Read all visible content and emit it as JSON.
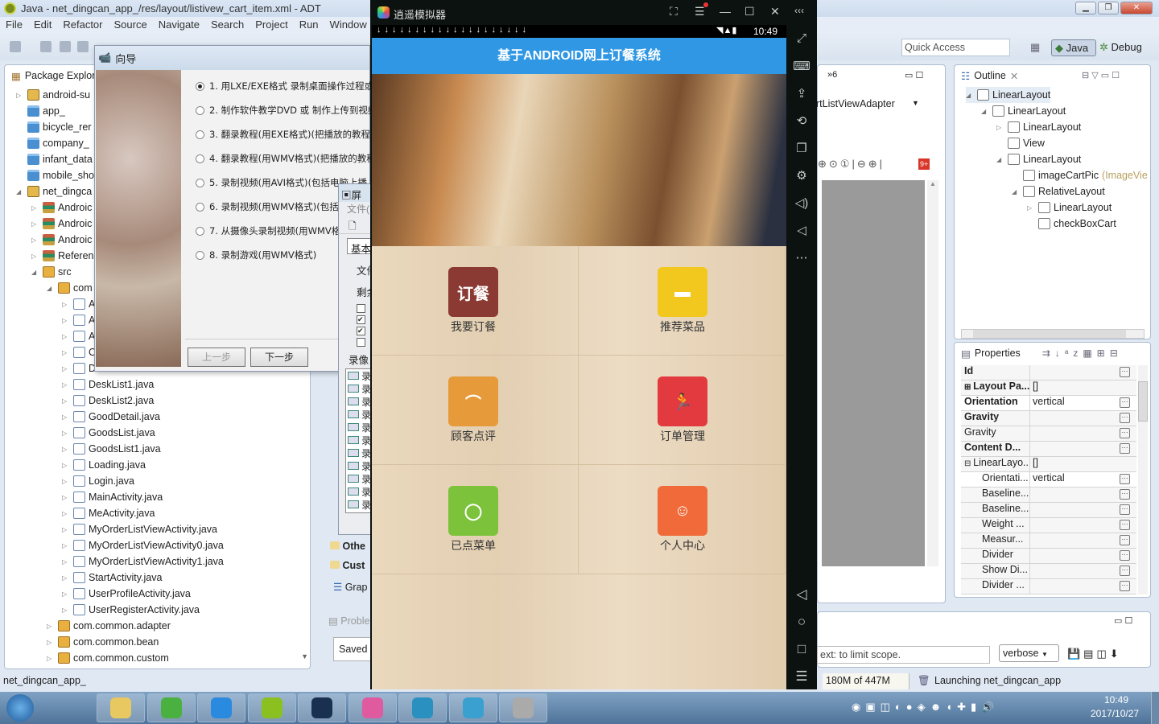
{
  "eclipse": {
    "title": "Java - net_dingcan_app_/res/layout/listivew_cart_item.xml - ADT",
    "menu": [
      "File",
      "Edit",
      "Refactor",
      "Source",
      "Navigate",
      "Search",
      "Project",
      "Run",
      "Window"
    ],
    "quick_access": "Quick Access",
    "perspectives": [
      "Java",
      "Debug"
    ]
  },
  "package_explorer": {
    "title": "Package Explore",
    "items": [
      {
        "label": "android-su",
        "indent": 0,
        "icon": "proj",
        "arrow": "▷"
      },
      {
        "label": "app_",
        "indent": 0,
        "icon": "folder",
        "arrow": ""
      },
      {
        "label": "bicycle_rer",
        "indent": 0,
        "icon": "folder",
        "arrow": ""
      },
      {
        "label": "company_",
        "indent": 0,
        "icon": "folder",
        "arrow": ""
      },
      {
        "label": "infant_data",
        "indent": 0,
        "icon": "folder",
        "arrow": ""
      },
      {
        "label": "mobile_sho",
        "indent": 0,
        "icon": "folder",
        "arrow": ""
      },
      {
        "label": "net_dingca",
        "indent": 0,
        "icon": "proj",
        "arrow": "◢"
      },
      {
        "label": "Androic",
        "indent": 1,
        "icon": "lib",
        "arrow": "▷"
      },
      {
        "label": "Androic",
        "indent": 1,
        "icon": "lib",
        "arrow": "▷"
      },
      {
        "label": "Androic",
        "indent": 1,
        "icon": "lib",
        "arrow": "▷"
      },
      {
        "label": "Referen",
        "indent": 1,
        "icon": "lib",
        "arrow": "▷"
      },
      {
        "label": "src",
        "indent": 1,
        "icon": "pkg",
        "arrow": "◢"
      },
      {
        "label": "com",
        "indent": 2,
        "icon": "pkg",
        "arrow": "◢"
      },
      {
        "label": "A",
        "indent": 3,
        "icon": "java",
        "arrow": "▷"
      },
      {
        "label": "A",
        "indent": 3,
        "icon": "java",
        "arrow": "▷"
      },
      {
        "label": "A",
        "indent": 3,
        "icon": "java",
        "arrow": "▷"
      },
      {
        "label": "C",
        "indent": 3,
        "icon": "java",
        "arrow": "▷"
      },
      {
        "label": "D",
        "indent": 3,
        "icon": "java",
        "arrow": "▷"
      },
      {
        "label": "DeskList1.java",
        "indent": 3,
        "icon": "java",
        "arrow": "▷"
      },
      {
        "label": "DeskList2.java",
        "indent": 3,
        "icon": "java",
        "arrow": "▷"
      },
      {
        "label": "GoodDetail.java",
        "indent": 3,
        "icon": "java",
        "arrow": "▷"
      },
      {
        "label": "GoodsList.java",
        "indent": 3,
        "icon": "java",
        "arrow": "▷"
      },
      {
        "label": "GoodsList1.java",
        "indent": 3,
        "icon": "java",
        "arrow": "▷"
      },
      {
        "label": "Loading.java",
        "indent": 3,
        "icon": "java",
        "arrow": "▷"
      },
      {
        "label": "Login.java",
        "indent": 3,
        "icon": "java",
        "arrow": "▷"
      },
      {
        "label": "MainActivity.java",
        "indent": 3,
        "icon": "java",
        "arrow": "▷"
      },
      {
        "label": "MeActivity.java",
        "indent": 3,
        "icon": "java",
        "arrow": "▷"
      },
      {
        "label": "MyOrderListViewActivity.java",
        "indent": 3,
        "icon": "java",
        "arrow": "▷"
      },
      {
        "label": "MyOrderListViewActivity0.java",
        "indent": 3,
        "icon": "java",
        "arrow": "▷"
      },
      {
        "label": "MyOrderListViewActivity1.java",
        "indent": 3,
        "icon": "java",
        "arrow": "▷"
      },
      {
        "label": "StartActivity.java",
        "indent": 3,
        "icon": "java",
        "arrow": "▷"
      },
      {
        "label": "UserProfileActivity.java",
        "indent": 3,
        "icon": "java",
        "arrow": "▷"
      },
      {
        "label": "UserRegisterActivity.java",
        "indent": 3,
        "icon": "java",
        "arrow": "▷"
      },
      {
        "label": "com.common.adapter",
        "indent": 2,
        "icon": "pkg",
        "arrow": "▷"
      },
      {
        "label": "com.common.bean",
        "indent": 2,
        "icon": "pkg",
        "arrow": "▷"
      },
      {
        "label": "com.common.custom",
        "indent": 2,
        "icon": "pkg",
        "arrow": "▷"
      }
    ]
  },
  "wizard": {
    "title": "向导",
    "options": [
      "1. 用LXE/EXE格式 录制桌面操作过程或",
      "2. 制作软件教学DVD 或 制作上传到视频",
      "3. 翻录教程(用EXE格式)(把播放的教程",
      "4. 翻录教程(用WMV格式)(把播放的教程",
      "5. 录制视频(用AVI格式)(包括电脑上播",
      "6. 录制视频(用WMV格式)(包括电脑上播",
      "7. 从摄像头录制视频(用WMV格式",
      "8. 录制游戏(用WMV格式)"
    ],
    "selected": 0,
    "prev": "上一步",
    "next": "下一步"
  },
  "dialog2": {
    "title": "屏",
    "menu": "文件(",
    "tab": "基本",
    "labels": [
      "文件",
      "剩余"
    ],
    "checks": [
      false,
      true,
      true,
      false
    ],
    "list_header": "录像",
    "list_items": [
      "录",
      "录",
      "录",
      "录",
      "录",
      "录",
      "录",
      "录",
      "录",
      "录",
      "录"
    ]
  },
  "left_lower": {
    "folders": [
      "Othe",
      "Cust"
    ],
    "graph": "Grap",
    "problems": "Proble",
    "saved": "Saved"
  },
  "emulator": {
    "title": "逍遥模拟器",
    "time": "10:49",
    "app_title": "基于ANDROID网上订餐系统",
    "menu_items": [
      {
        "label": "我要订餐",
        "glyph": "订餐",
        "color": "#8a3a32"
      },
      {
        "label": "推荐菜品",
        "glyph": "▬",
        "color": "#f3c81e"
      },
      {
        "label": "顾客点评",
        "glyph": "⌒",
        "color": "#e69a3a"
      },
      {
        "label": "订单管理",
        "glyph": "🏃",
        "color": "#e23a3e"
      },
      {
        "label": "已点菜单",
        "glyph": "◯",
        "color": "#7cc23a"
      },
      {
        "label": "个人中心",
        "glyph": "☺",
        "color": "#f06a3a"
      }
    ],
    "side_icons": [
      "fullscreen-icon",
      "keyboard-icon",
      "apk-install-icon",
      "screen-rotate-icon",
      "multi-window-icon",
      "settings-icon",
      "volume-up-icon",
      "volume-down-icon",
      "more-icon"
    ],
    "nav_icons": [
      "back-icon",
      "home-icon",
      "recents-icon",
      "menu-icon"
    ]
  },
  "editor": {
    "overflow": "»6",
    "class_combo": "rtListViewAdapter"
  },
  "outline": {
    "title": "Outline",
    "items": [
      {
        "label": "LinearLayout",
        "indent": 0,
        "arrow": "◢"
      },
      {
        "label": "LinearLayout",
        "indent": 1,
        "arrow": "◢"
      },
      {
        "label": "LinearLayout",
        "indent": 2,
        "arrow": "▷"
      },
      {
        "label": "View",
        "indent": 2,
        "arrow": ""
      },
      {
        "label": "LinearLayout",
        "indent": 2,
        "arrow": "◢"
      },
      {
        "label": "imageCartPic",
        "extra": "(ImageVie",
        "indent": 3,
        "arrow": ""
      },
      {
        "label": "RelativeLayout",
        "indent": 3,
        "arrow": "◢"
      },
      {
        "label": "LinearLayout",
        "indent": 4,
        "arrow": "▷"
      },
      {
        "label": "checkBoxCart",
        "indent": 4,
        "arrow": ""
      }
    ]
  },
  "properties": {
    "title": "Properties",
    "rows": [
      {
        "k": "Id",
        "v": "",
        "bold": true,
        "btn": true
      },
      {
        "k": "Layout Pa...",
        "v": "[]",
        "bold": true,
        "btn": false,
        "pre": "⊞"
      },
      {
        "k": "Orientation",
        "v": "vertical",
        "bold": true,
        "btn": true
      },
      {
        "k": "Gravity",
        "v": "",
        "bold": true,
        "btn": true
      },
      {
        "k": "Gravity",
        "v": "",
        "bold": false,
        "btn": true
      },
      {
        "k": "Content D...",
        "v": "",
        "bold": true,
        "btn": true
      },
      {
        "k": "LinearLayo...",
        "v": "[]",
        "bold": false,
        "btn": false,
        "pre": "⊟"
      },
      {
        "k": "Orientati...",
        "v": "vertical",
        "bold": false,
        "btn": true,
        "sub": true
      },
      {
        "k": "Baseline...",
        "v": "",
        "bold": false,
        "btn": true,
        "sub": true
      },
      {
        "k": "Baseline...",
        "v": "",
        "bold": false,
        "btn": true,
        "sub": true
      },
      {
        "k": "Weight ...",
        "v": "",
        "bold": false,
        "btn": true,
        "sub": true
      },
      {
        "k": "Measur...",
        "v": "",
        "bold": false,
        "btn": true,
        "sub": true
      },
      {
        "k": "Divider",
        "v": "",
        "bold": false,
        "btn": true,
        "sub": true
      },
      {
        "k": "Show Di...",
        "v": "",
        "bold": false,
        "btn": true,
        "sub": true
      },
      {
        "k": "Divider ...",
        "v": "",
        "bold": false,
        "btn": true,
        "sub": true
      }
    ]
  },
  "console": {
    "filter_placeholder": "ext: to limit scope.",
    "level": "verbose"
  },
  "statusbar": {
    "left": "net_dingcan_app_",
    "memory": "180M of 447M",
    "task": "Launching net_dingcan_app"
  },
  "taskbar": {
    "apps": [
      "file-explorer",
      "ie-browser",
      "baidu-netdisk",
      "brackets",
      "typora",
      "xiaoyao-emulator",
      "media-player",
      "thunder",
      "screen-recorder"
    ],
    "time": "10:49",
    "date": "2017/10/27"
  },
  "colors": {
    "appbar": "#2f97e4",
    "emulator_bg": "#0b1210"
  }
}
